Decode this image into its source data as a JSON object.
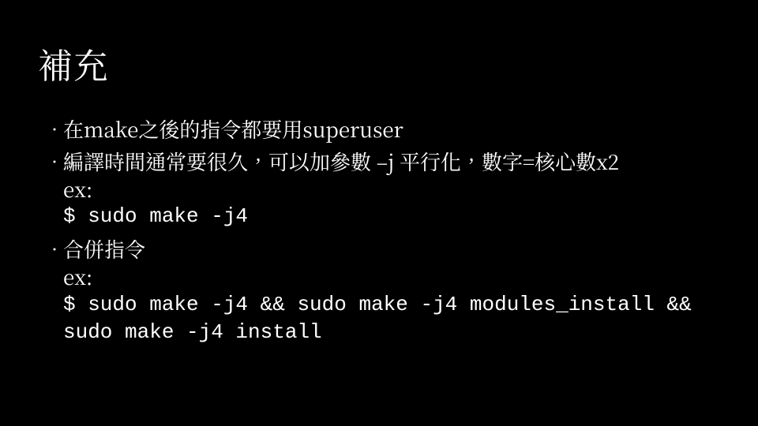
{
  "title": "補充",
  "bullets": [
    {
      "line1": "在make之後的指令都要用superuser"
    },
    {
      "line1": "編譯時間通常要很久，可以加參數 –j 平行化，數字=核心數x2",
      "line2": "ex:",
      "line3": "$ sudo make -j4"
    },
    {
      "line1": "合併指令",
      "line2": "ex:",
      "line3": "$ sudo make -j4 && sudo make -j4 modules_install && sudo make -j4 install"
    }
  ]
}
